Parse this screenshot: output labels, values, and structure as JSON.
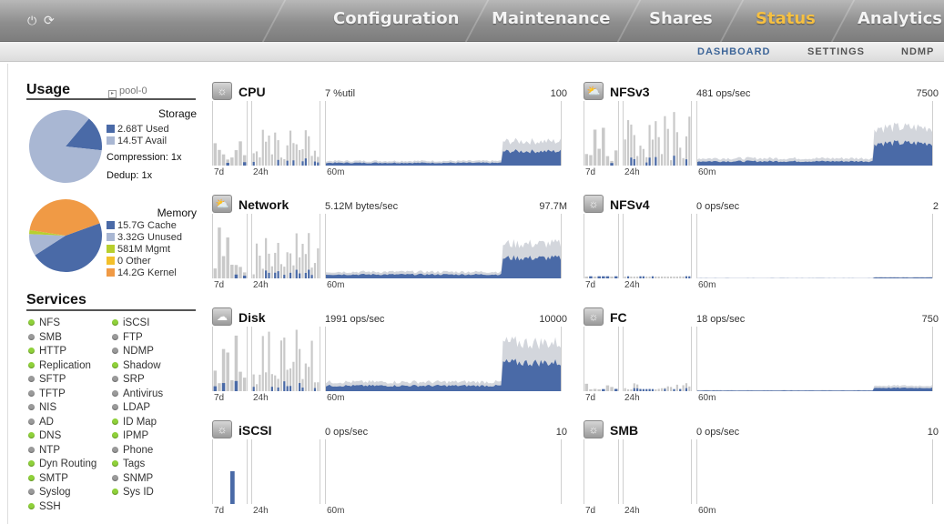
{
  "topbar": {
    "power_glyph": "⏻",
    "refresh_glyph": "⟳",
    "tabs": [
      "Configuration",
      "Maintenance",
      "Shares",
      "Status",
      "Analytics"
    ],
    "active_tab": "Status"
  },
  "subnav": {
    "tabs": [
      "DASHBOARD",
      "SETTINGS",
      "NDMP"
    ],
    "active": "DASHBOARD"
  },
  "usage": {
    "title": "Usage",
    "pool": "pool-0",
    "storage": {
      "heading": "Storage",
      "items": [
        {
          "label": "2.68T Used",
          "color": "#4a6aa7",
          "value": 2.68
        },
        {
          "label": "14.5T Avail",
          "color": "#a9b7d3",
          "value": 14.5
        }
      ],
      "compression": "Compression: 1x",
      "dedup": "Dedup: 1x"
    },
    "memory": {
      "heading": "Memory",
      "items": [
        {
          "label": "15.7G Cache",
          "color": "#4a6aa7",
          "value": 15.7
        },
        {
          "label": "3.32G Unused",
          "color": "#a9b7d3",
          "value": 3.32
        },
        {
          "label": "581M Mgmt",
          "color": "#b8cf2e",
          "value": 0.581
        },
        {
          "label": "0 Other",
          "color": "#f3c02b",
          "value": 0
        },
        {
          "label": "14.2G Kernel",
          "color": "#f09a45",
          "value": 14.2
        }
      ]
    }
  },
  "services": {
    "title": "Services",
    "left": [
      {
        "name": "NFS",
        "on": true
      },
      {
        "name": "SMB",
        "on": false
      },
      {
        "name": "HTTP",
        "on": true
      },
      {
        "name": "Replication",
        "on": true
      },
      {
        "name": "SFTP",
        "on": false
      },
      {
        "name": "TFTP",
        "on": false
      },
      {
        "name": "NIS",
        "on": false
      },
      {
        "name": "AD",
        "on": false
      },
      {
        "name": "DNS",
        "on": true
      },
      {
        "name": "NTP",
        "on": false
      },
      {
        "name": "Dyn Routing",
        "on": true
      },
      {
        "name": "SMTP",
        "on": true
      },
      {
        "name": "Syslog",
        "on": false
      },
      {
        "name": "SSH",
        "on": true
      }
    ],
    "right": [
      {
        "name": "iSCSI",
        "on": true
      },
      {
        "name": "FTP",
        "on": false
      },
      {
        "name": "NDMP",
        "on": false
      },
      {
        "name": "Shadow",
        "on": true
      },
      {
        "name": "SRP",
        "on": false
      },
      {
        "name": "Antivirus",
        "on": false
      },
      {
        "name": "LDAP",
        "on": false
      },
      {
        "name": "ID Map",
        "on": true
      },
      {
        "name": "IPMP",
        "on": true
      },
      {
        "name": "Phone",
        "on": false
      },
      {
        "name": "Tags",
        "on": true
      },
      {
        "name": "SNMP",
        "on": false
      },
      {
        "name": "Sys ID",
        "on": true
      }
    ]
  },
  "widgets": [
    {
      "name": "CPU",
      "value": "7 %util",
      "max": "100",
      "icon": "sun-icon"
    },
    {
      "name": "NFSv3",
      "value": "481 ops/sec",
      "max": "7500",
      "icon": "partly-cloudy-icon"
    },
    {
      "name": "Network",
      "value": "5.12M bytes/sec",
      "max": "97.7M",
      "icon": "partly-cloudy-icon"
    },
    {
      "name": "NFSv4",
      "value": "0 ops/sec",
      "max": "2",
      "icon": "sun-icon"
    },
    {
      "name": "Disk",
      "value": "1991 ops/sec",
      "max": "10000",
      "icon": "cloud-icon"
    },
    {
      "name": "FC",
      "value": "18 ops/sec",
      "max": "750",
      "icon": "sun-icon"
    },
    {
      "name": "iSCSI",
      "value": "0 ops/sec",
      "max": "10",
      "icon": "sun-icon"
    },
    {
      "name": "SMB",
      "value": "0 ops/sec",
      "max": "10",
      "icon": "sun-icon"
    }
  ],
  "time_labels": [
    "7d",
    "24h",
    "60m"
  ],
  "colors": {
    "series_fill": "#4a6aa7",
    "series_range": "#d3d6dc",
    "history_bar": "#c9c9c9"
  }
}
